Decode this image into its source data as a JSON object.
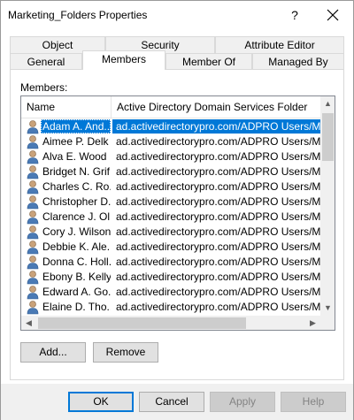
{
  "window": {
    "title": "Marketing_Folders Properties",
    "help_glyph": "?",
    "close_icon": "close-icon"
  },
  "tabs": {
    "row1": [
      {
        "label": "Object"
      },
      {
        "label": "Security"
      },
      {
        "label": "Attribute Editor"
      }
    ],
    "row2": [
      {
        "label": "General"
      },
      {
        "label": "Members"
      },
      {
        "label": "Member Of"
      },
      {
        "label": "Managed By"
      }
    ],
    "active": "Members"
  },
  "members": {
    "label": "Members:",
    "columns": [
      {
        "label": "Name"
      },
      {
        "label": "Active Directory Domain Services Folder"
      }
    ],
    "rows": [
      {
        "name": "Adam A. And...",
        "folder": "ad.activedirectorypro.com/ADPRO Users/Marke",
        "selected": true
      },
      {
        "name": "Aimee P. Delk",
        "folder": "ad.activedirectorypro.com/ADPRO Users/Marke"
      },
      {
        "name": "Alva E. Wood",
        "folder": "ad.activedirectorypro.com/ADPRO Users/Marke"
      },
      {
        "name": "Bridget N. Grif...",
        "folder": "ad.activedirectorypro.com/ADPRO Users/Marke"
      },
      {
        "name": "Charles C. Ro...",
        "folder": "ad.activedirectorypro.com/ADPRO Users/Marke"
      },
      {
        "name": "Christopher D....",
        "folder": "ad.activedirectorypro.com/ADPRO Users/Marke"
      },
      {
        "name": "Clarence J. Ol...",
        "folder": "ad.activedirectorypro.com/ADPRO Users/Marke"
      },
      {
        "name": "Cory J. Wilson",
        "folder": "ad.activedirectorypro.com/ADPRO Users/Marke"
      },
      {
        "name": "Debbie K. Ale...",
        "folder": "ad.activedirectorypro.com/ADPRO Users/Marke"
      },
      {
        "name": "Donna C. Holl...",
        "folder": "ad.activedirectorypro.com/ADPRO Users/Marke"
      },
      {
        "name": "Ebony B. Kelly",
        "folder": "ad.activedirectorypro.com/ADPRO Users/Marke"
      },
      {
        "name": "Edward A. Go...",
        "folder": "ad.activedirectorypro.com/ADPRO Users/Marke"
      },
      {
        "name": "Elaine D. Tho...",
        "folder": "ad.activedirectorypro.com/ADPRO Users/Marke"
      }
    ],
    "row_icon": "user-icon",
    "add_label": "Add...",
    "remove_label": "Remove"
  },
  "footer": {
    "ok_label": "OK",
    "cancel_label": "Cancel",
    "apply_label": "Apply",
    "help_label": "Help"
  },
  "colors": {
    "selection": "#0078d7",
    "user_icon": "#4a7ab5"
  }
}
